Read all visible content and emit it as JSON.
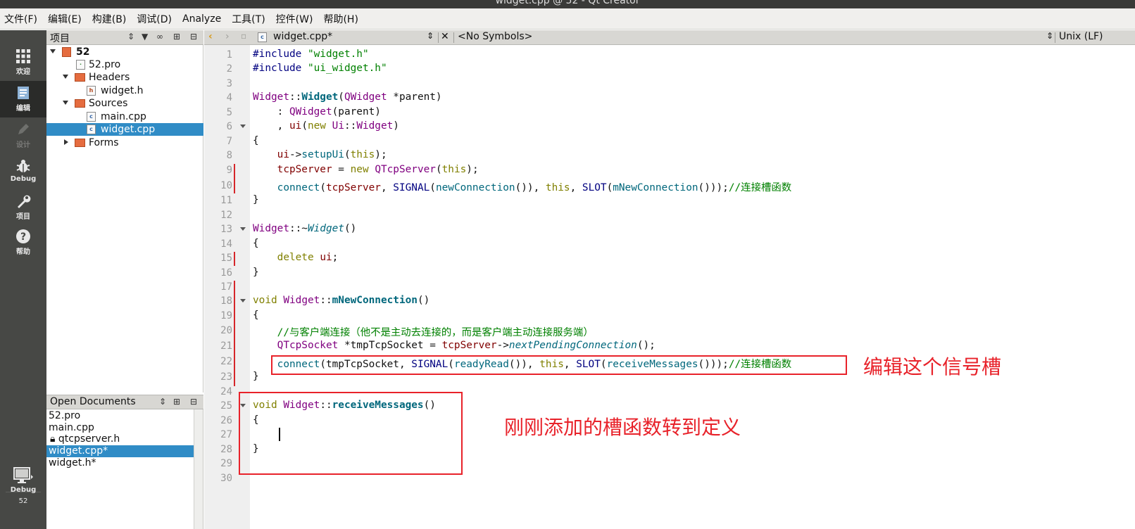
{
  "window": {
    "title": "widget.cpp @ 52 - Qt Creator"
  },
  "menu": [
    "文件(F)",
    "编辑(E)",
    "构建(B)",
    "调试(D)",
    "Analyze",
    "工具(T)",
    "控件(W)",
    "帮助(H)"
  ],
  "modes": {
    "welcome": "欢迎",
    "edit": "编辑",
    "design": "设计",
    "debug": "Debug",
    "projects": "项目",
    "help": "帮助",
    "kit_name": "52",
    "kit_mode": "Debug"
  },
  "project_panel": {
    "title": "项目",
    "tree": {
      "root": "52",
      "pro": "52.pro",
      "headers": "Headers",
      "header_file": "widget.h",
      "sources": "Sources",
      "main": "main.cpp",
      "widget": "widget.cpp",
      "forms": "Forms"
    }
  },
  "open_documents": {
    "title": "Open Documents",
    "items": [
      "52.pro",
      "main.cpp",
      "qtcpserver.h",
      "widget.cpp*",
      "widget.h*"
    ]
  },
  "editor": {
    "file": "widget.cpp*",
    "symbols": "<No Symbols>",
    "line_ending": "Unix (LF)",
    "line_numbers": [
      "1",
      "2",
      "3",
      "4",
      "5",
      "6",
      "7",
      "8",
      "9",
      "10",
      "11",
      "12",
      "13",
      "14",
      "15",
      "16",
      "17",
      "18",
      "19",
      "20",
      "21",
      "22",
      "23",
      "24",
      "25",
      "26",
      "27",
      "28",
      "29",
      "30"
    ],
    "code": {
      "l1": [
        "#include ",
        "\"widget.h\""
      ],
      "l2": [
        "#include ",
        "\"ui_widget.h\""
      ],
      "l4": [
        "Widget",
        "::",
        "Widget",
        "(",
        "QWidget",
        " *parent)"
      ],
      "l5": [
        "    : ",
        "QWidget",
        "(parent)"
      ],
      "l6": [
        "    , ",
        "ui",
        "(",
        "new",
        " ",
        "Ui",
        "::",
        "Widget",
        ")"
      ],
      "l7": "{",
      "l8": [
        "    ",
        "ui",
        "->",
        "setupUi",
        "(",
        "this",
        ");"
      ],
      "l9": [
        "    ",
        "tcpServer",
        " = ",
        "new",
        " ",
        "QTcpServer",
        "(",
        "this",
        ");"
      ],
      "l10": [
        "    ",
        "connect",
        "(",
        "tcpServer",
        ", ",
        "SIGNAL",
        "(",
        "newConnection",
        "()), ",
        "this",
        ", ",
        "SLOT",
        "(",
        "mNewConnection",
        "()));",
        "//连接槽函数"
      ],
      "l11": "}",
      "l13": [
        "Widget",
        "::~",
        "Widget",
        "()"
      ],
      "l14": "{",
      "l15": [
        "    ",
        "delete",
        " ",
        "ui",
        ";"
      ],
      "l16": "}",
      "l18": [
        "void",
        " ",
        "Widget",
        "::",
        "mNewConnection",
        "()"
      ],
      "l19": "{",
      "l20": [
        "    ",
        "//与客户端连接（他不是主动去连接的，而是客户端主动连接服务端）"
      ],
      "l21": [
        "    ",
        "QTcpSocket",
        " *tmpTcpSocket = ",
        "tcpServer",
        "->",
        "nextPendingConnection",
        "();"
      ],
      "l22": [
        "    ",
        "connect",
        "(tmpTcpSocket, ",
        "SIGNAL",
        "(",
        "readyRead",
        "()), ",
        "this",
        ", ",
        "SLOT",
        "(",
        "receiveMessages",
        "()));",
        "//连接槽函数"
      ],
      "l23": "}",
      "l25": [
        "void",
        " ",
        "Widget",
        "::",
        "receiveMessages",
        "()"
      ],
      "l26": "{",
      "l28": "}"
    }
  },
  "annotations": {
    "signal_slot": "编辑这个信号槽",
    "goto_definition": "刚刚添加的槽函数转到定义",
    "color": "#e8222a"
  }
}
